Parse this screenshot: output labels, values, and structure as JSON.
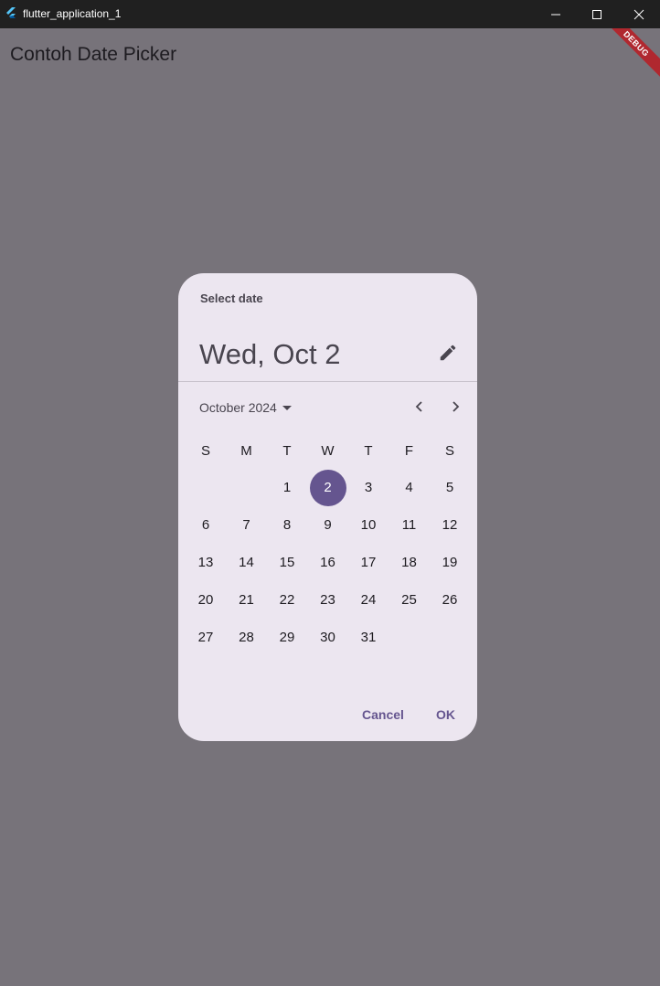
{
  "window": {
    "title": "flutter_application_1"
  },
  "app": {
    "title": "Contoh Date Picker",
    "debug_label": "DEBUG"
  },
  "dialog": {
    "header_label": "Select date",
    "selected_text": "Wed, Oct 2",
    "month_label": "October 2024",
    "weekdays": [
      "S",
      "M",
      "T",
      "W",
      "T",
      "F",
      "S"
    ],
    "days": [
      "1",
      "2",
      "3",
      "4",
      "5",
      "6",
      "7",
      "8",
      "9",
      "10",
      "11",
      "12",
      "13",
      "14",
      "15",
      "16",
      "17",
      "18",
      "19",
      "20",
      "21",
      "22",
      "23",
      "24",
      "25",
      "26",
      "27",
      "28",
      "29",
      "30",
      "31"
    ],
    "selected_day": "2",
    "cancel_label": "Cancel",
    "ok_label": "OK"
  },
  "colors": {
    "accent": "#65558f",
    "dialog_bg": "#ece6f0",
    "scrim": "#77737a",
    "titlebar": "#202020"
  },
  "icons": {
    "app": "flutter-icon",
    "edit": "pencil-icon",
    "prev": "chevron-left-icon",
    "next": "chevron-right-icon",
    "dropdown": "caret-down-icon"
  }
}
